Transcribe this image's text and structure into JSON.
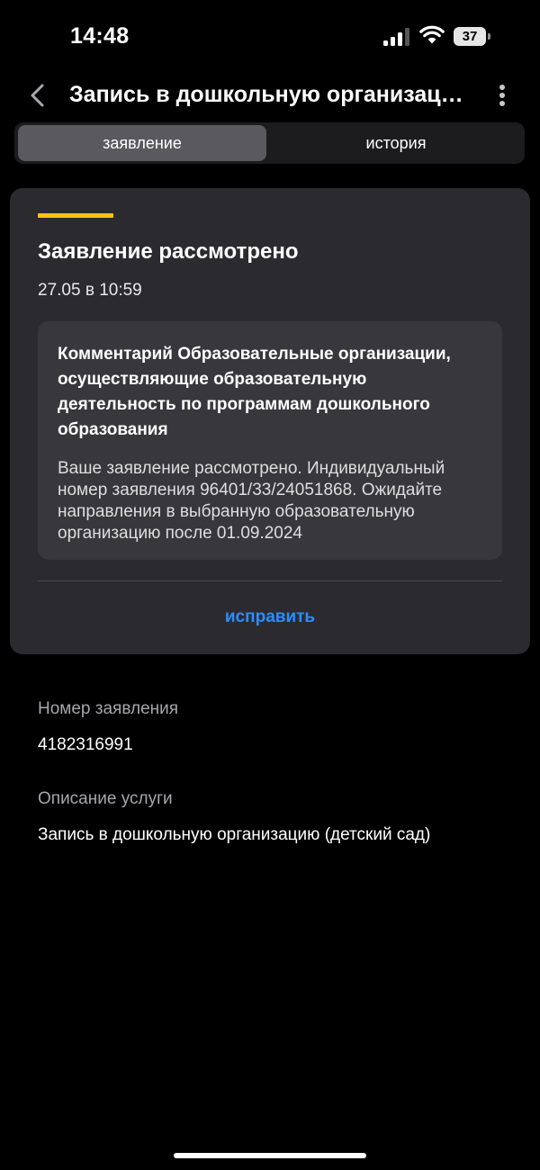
{
  "status_bar": {
    "time": "14:48",
    "battery": "37",
    "icons": [
      "signal-icon",
      "wifi-icon",
      "battery-icon"
    ]
  },
  "header": {
    "title": "Запись в дошкольную организации...",
    "back_icon": "chevron-left-icon",
    "more_icon": "more-vertical-icon"
  },
  "tabs": [
    {
      "label": "заявление",
      "active": true
    },
    {
      "label": "история",
      "active": false
    }
  ],
  "status_card": {
    "accent_color": "#ffc20e",
    "title": "Заявление рассмотрено",
    "date": "27.05 в 10:59",
    "comment_title": "Комментарий Образовательные организации, осуществляющие образовательную деятельность по программам дошкольного образования",
    "comment_body": "Ваше заявление рассмотрено. Индивидуальный номер заявления 96401/33/24051868. Ожидайте направления в выбранную образовательную организацию после 01.09.2024",
    "action_label": "исправить",
    "action_color": "#2d8cff"
  },
  "details": {
    "number_label": "Номер заявления",
    "number_value": "4182316991",
    "service_label": "Описание услуги",
    "service_value": "Запись в дошкольную организацию (детский сад)"
  },
  "colors": {
    "background": "#000000",
    "card": "#2b2b2f",
    "comment_box": "#38383c"
  }
}
